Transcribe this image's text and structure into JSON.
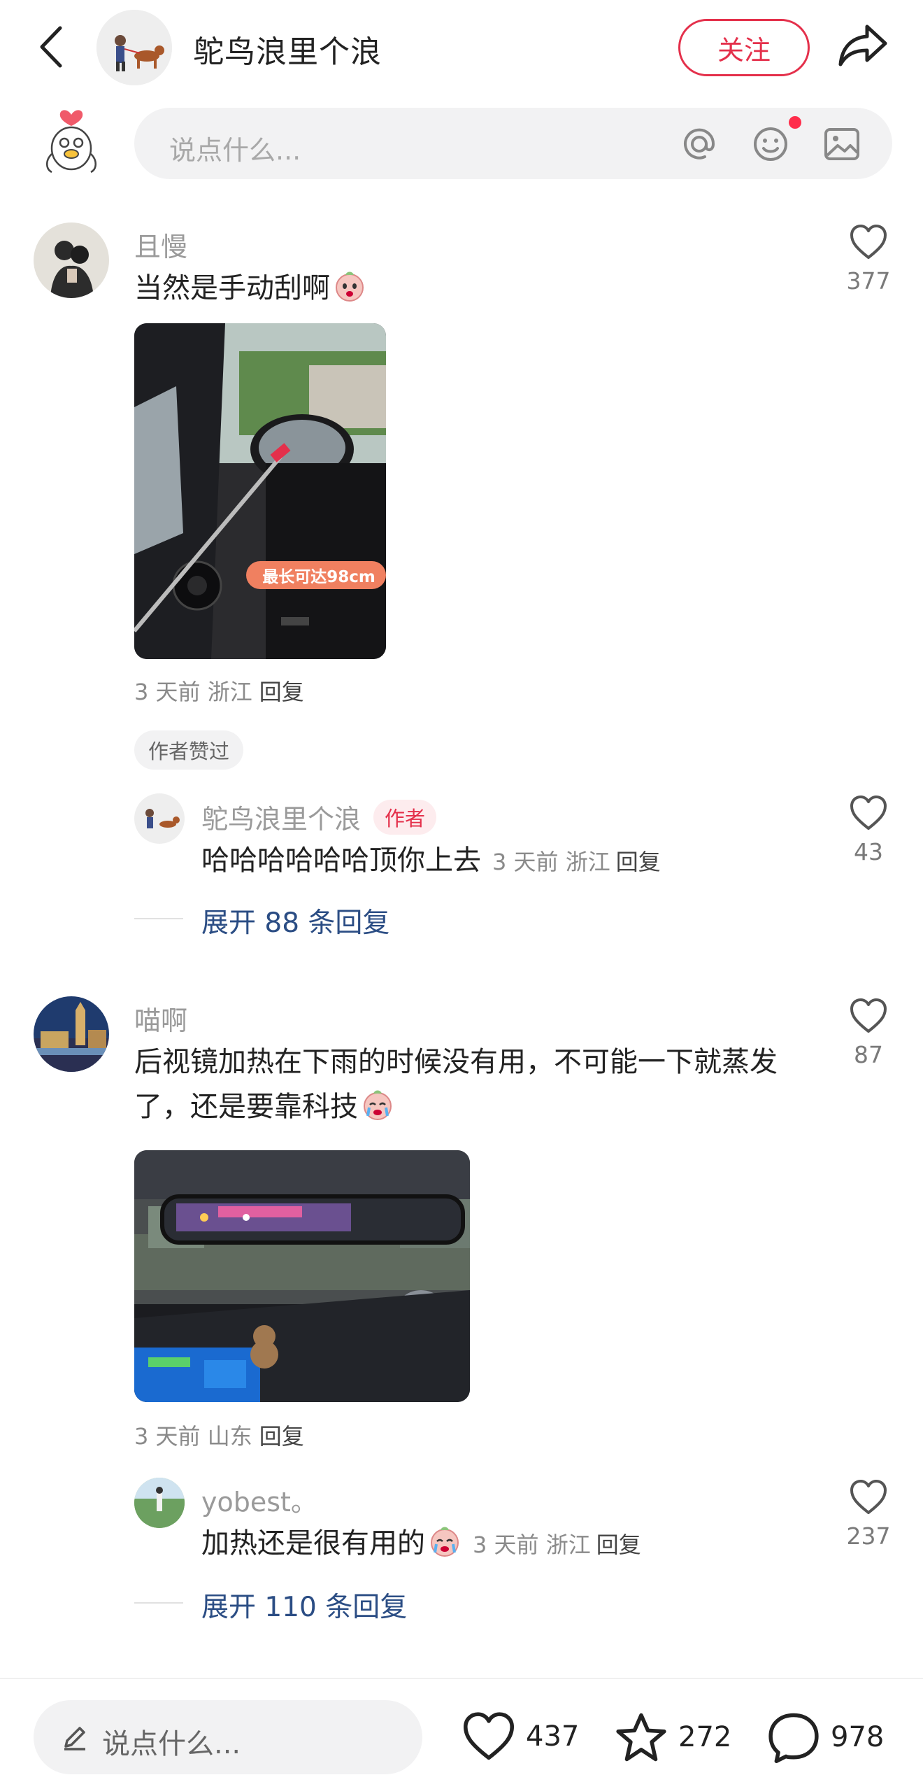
{
  "header": {
    "username": "鸵鸟浪里个浪",
    "follow_label": "关注"
  },
  "compose": {
    "placeholder": "说点什么..."
  },
  "comments": [
    {
      "user": "且慢",
      "text": "当然是手动刮啊",
      "likes": "377",
      "image_overlay": "最长可达98cm",
      "meta_time": "3 天前",
      "meta_loc": "浙江",
      "reply_label": "回复",
      "badge": "作者赞过",
      "sub_reply": {
        "user": "鸵鸟浪里个浪",
        "tag": "作者",
        "text": "哈哈哈哈哈哈顶你上去",
        "meta_time": "3 天前",
        "meta_loc": "浙江",
        "reply_label": "回复",
        "likes": "43"
      },
      "expand_label": "展开 88 条回复"
    },
    {
      "user": "喵啊",
      "text_line1": "后视镜加热在下雨的时候没有用，不可能一下就蒸发",
      "text_line2": "了，还是要靠科技",
      "likes": "87",
      "meta_time": "3 天前",
      "meta_loc": "山东",
      "reply_label": "回复",
      "sub_reply": {
        "user": "yobest。",
        "text": "加热还是很有用的",
        "meta_time": "3 天前",
        "meta_loc": "浙江",
        "reply_label": "回复",
        "likes": "237"
      },
      "expand_label": "展开 110 条回复"
    }
  ],
  "bottom_bar": {
    "placeholder": "说点什么...",
    "likes": "437",
    "collects": "272",
    "comments": "978"
  },
  "colors": {
    "accent": "#e4304b",
    "link": "#2b4d84",
    "muted": "#9a9a9a"
  }
}
